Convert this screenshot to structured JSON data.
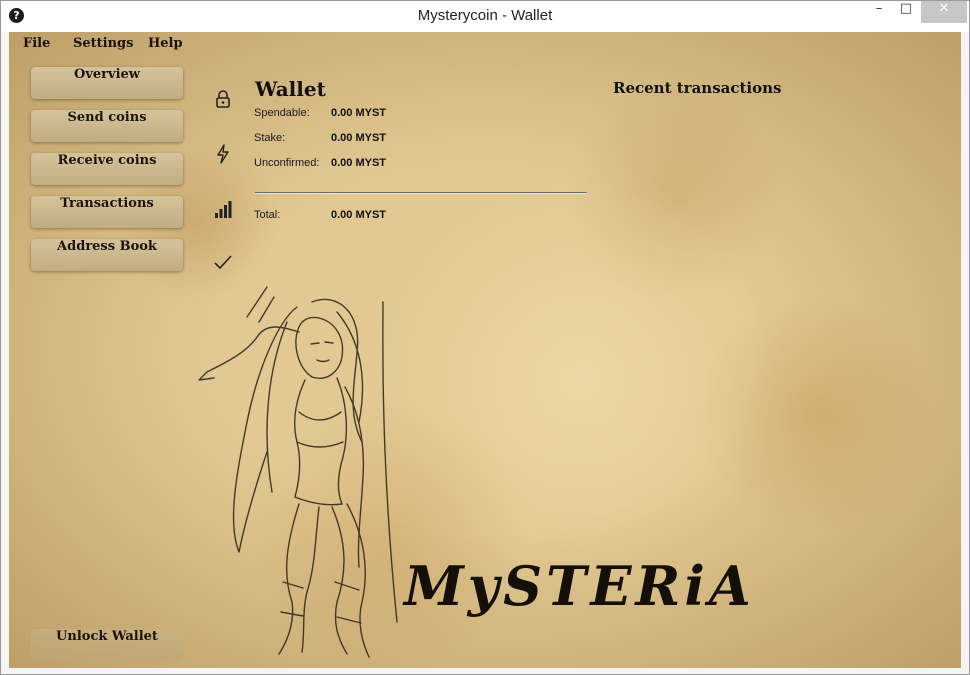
{
  "window": {
    "title": "Mysterycoin - Wallet",
    "app_icon": "?",
    "controls": {
      "minimize": "–",
      "maximize": "□",
      "close": "✕"
    }
  },
  "menu": {
    "file": "File",
    "settings": "Settings",
    "help": "Help"
  },
  "nav": {
    "overview": "Overview",
    "send": "Send coins",
    "receive": "Receive coins",
    "transactions": "Transactions",
    "address_book": "Address Book",
    "unlock": "Unlock Wallet"
  },
  "status_icons": [
    "lock-icon",
    "lightning-icon",
    "signal-icon",
    "check-icon"
  ],
  "wallet": {
    "title": "Wallet",
    "spendable_label": "Spendable:",
    "spendable_value": "0.00 MYST",
    "stake_label": "Stake:",
    "stake_value": "0.00 MYST",
    "unconfirmed_label": "Unconfirmed:",
    "unconfirmed_value": "0.00 MYST",
    "total_label": "Total:",
    "total_value": "0.00 MYST"
  },
  "recent": {
    "title": "Recent transactions"
  },
  "brand": {
    "logo_text": "MySTERiA"
  },
  "colors": {
    "parchment": "#e2c993",
    "button": "#ccb88e",
    "ink": "#1a1208"
  }
}
